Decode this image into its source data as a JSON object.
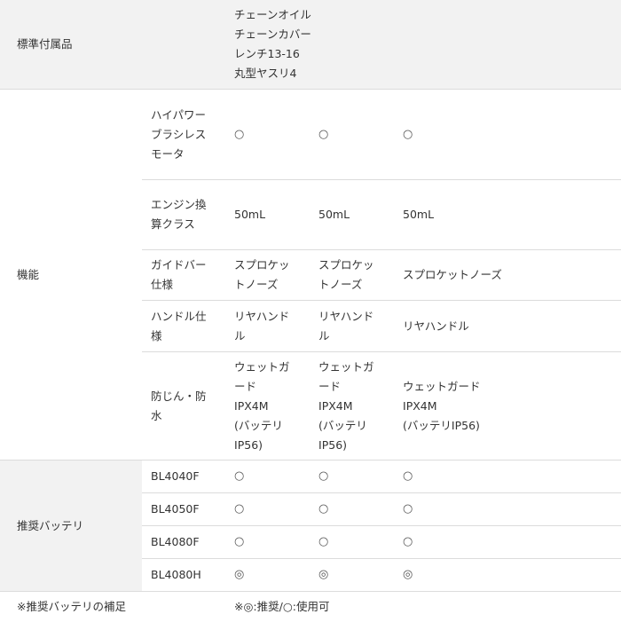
{
  "rows": {
    "accessories": {
      "label": "標準付属品",
      "items": "チェーンオイル\nチェーンカバー\nレンチ13-16\n丸型ヤスリ4"
    },
    "function": {
      "label": "機能",
      "brushless": {
        "label": "ハイパワーブラシレスモータ",
        "values": [
          "○",
          "○",
          "○"
        ]
      },
      "engine": {
        "label": "エンジン換算クラス",
        "values": [
          "50mL",
          "50mL",
          "50mL"
        ]
      },
      "guide_bar": {
        "label": "ガイドバー仕様",
        "values": [
          "スプロケットノーズ",
          "スプロケットノーズ",
          "スプロケットノーズ"
        ]
      },
      "handle": {
        "label": "ハンドル仕様",
        "values": [
          "リヤハンドル",
          "リヤハンドル",
          "リヤハンドル"
        ]
      },
      "waterproof": {
        "label": "防じん・防水",
        "values": [
          "ウェットガード\nIPX4M\n(バッテリIP56)",
          "ウェットガード\nIPX4M\n(バッテリIP56)",
          "ウェットガード\nIPX4M\n(バッテリIP56)"
        ]
      }
    },
    "battery": {
      "label": "推奨バッテリ",
      "models": [
        {
          "name": "BL4040F",
          "values": [
            "○",
            "○",
            "○"
          ]
        },
        {
          "name": "BL4050F",
          "values": [
            "○",
            "○",
            "○"
          ]
        },
        {
          "name": "BL4080F",
          "values": [
            "○",
            "○",
            "○"
          ]
        },
        {
          "name": "BL4080H",
          "values": [
            "◎",
            "◎",
            "◎"
          ]
        }
      ]
    },
    "note": {
      "label": "※推奨バッテリの補足",
      "text": "※◎:推奨/○:使用可"
    }
  }
}
